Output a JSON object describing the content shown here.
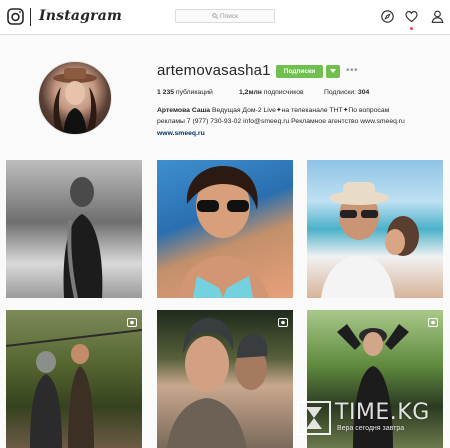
{
  "nav": {
    "wordmark": "Instagram",
    "search_placeholder": "Поиск",
    "icons": [
      "instagram-glyph-icon",
      "compass-icon",
      "heart-icon",
      "person-icon"
    ],
    "notification_color": "#ed4956"
  },
  "profile": {
    "username": "artemovasasha1",
    "follow_label": "Подписки",
    "more": "•••",
    "stats": {
      "posts_value": "1 235",
      "posts_label": "публикаций",
      "followers_value": "1,2млн",
      "followers_label": "подписчиков",
      "following_label": "Подписки:",
      "following_value": "304"
    },
    "bio": {
      "name": "Артемова Саша",
      "line1_rest": "Ведущая Дом-2 Live✦на телеканале ТНТ✦По вопросам",
      "line2": "рекламы 7 (977) 730-93-02 info@smeeq.ru Рекламное агентство www.smeeq.ru",
      "link": "www.smeeq.ru"
    },
    "accent_color": "#70c050"
  },
  "grid": {
    "photos": [
      {
        "desc": "photo-1",
        "video": false
      },
      {
        "desc": "photo-2",
        "video": false
      },
      {
        "desc": "photo-3",
        "video": false
      },
      {
        "desc": "photo-4",
        "video": true
      },
      {
        "desc": "photo-5",
        "video": true
      },
      {
        "desc": "photo-6",
        "video": true
      }
    ]
  },
  "watermark": {
    "title": "TIME.KG",
    "subtitle": "Вера сегодня завтра"
  }
}
